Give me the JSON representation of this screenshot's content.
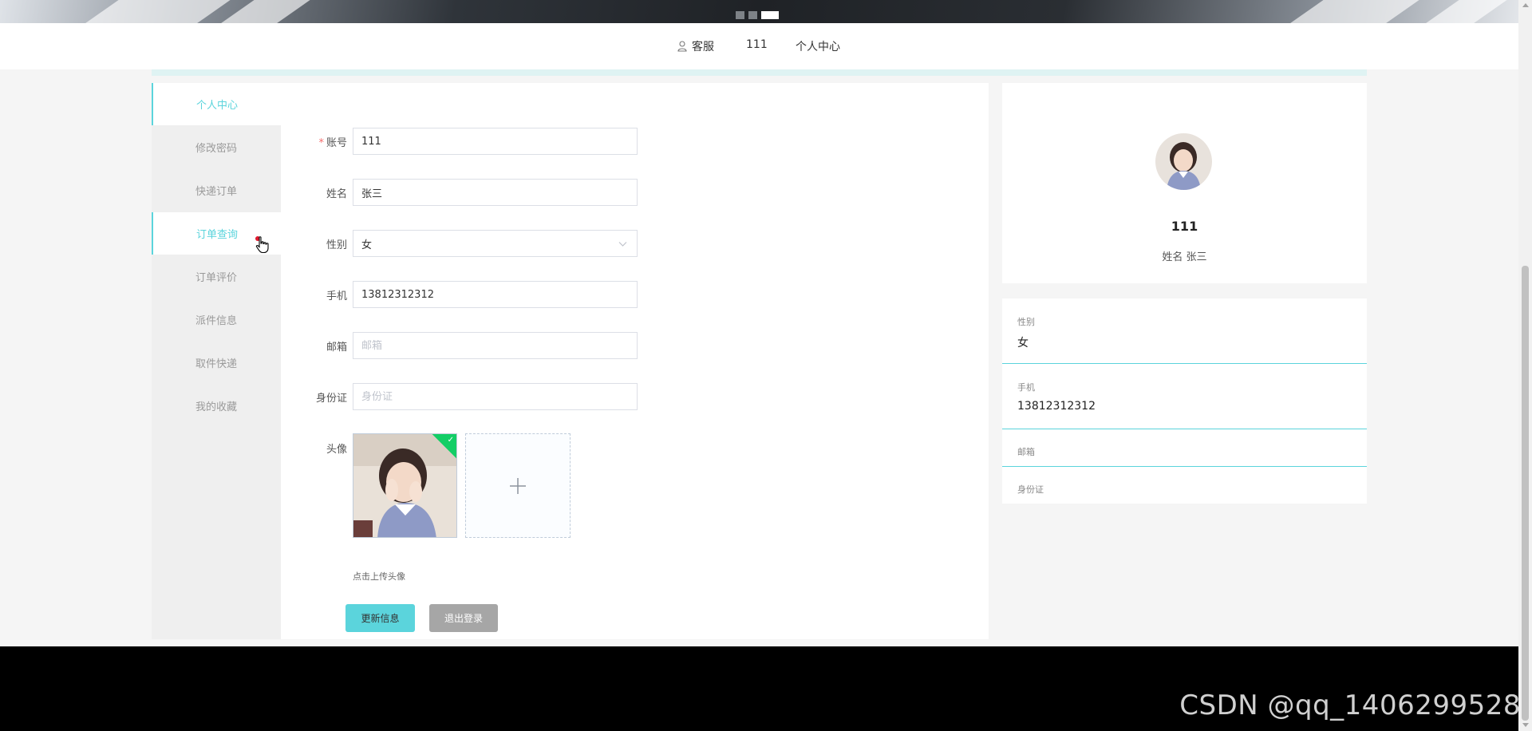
{
  "header": {
    "nav": {
      "customer_service": "客服",
      "username": "111",
      "personal_center": "个人中心"
    }
  },
  "sidebar": {
    "items": [
      {
        "label": "个人中心"
      },
      {
        "label": "修改密码"
      },
      {
        "label": "快递订单"
      },
      {
        "label": "订单查询"
      },
      {
        "label": "订单评价"
      },
      {
        "label": "派件信息"
      },
      {
        "label": "取件快递"
      },
      {
        "label": "我的收藏"
      }
    ]
  },
  "form": {
    "account": {
      "label": "账号",
      "value": "111"
    },
    "name": {
      "label": "姓名",
      "value": "张三"
    },
    "gender": {
      "label": "性别",
      "value": "女"
    },
    "phone": {
      "label": "手机",
      "value": "13812312312"
    },
    "email": {
      "label": "邮箱",
      "value": "",
      "placeholder": "邮箱"
    },
    "id_card": {
      "label": "身份证",
      "value": "",
      "placeholder": "身份证"
    },
    "avatar": {
      "label": "头像",
      "hint": "点击上传头像"
    },
    "update_button": "更新信息",
    "logout_button": "退出登录"
  },
  "profile_card": {
    "username": "111",
    "name_line": "姓名 张三"
  },
  "info": [
    {
      "label": "性别",
      "value": "女"
    },
    {
      "label": "手机",
      "value": "13812312312"
    },
    {
      "label": "邮箱",
      "value": ""
    },
    {
      "label": "身份证",
      "value": ""
    }
  ],
  "watermark": "CSDN @qq_1406299528",
  "colors": {
    "accent": "#5bd4dc",
    "logout": "#a6a6a6",
    "upload_success": "#13ce66",
    "required": "#f56c6c"
  }
}
